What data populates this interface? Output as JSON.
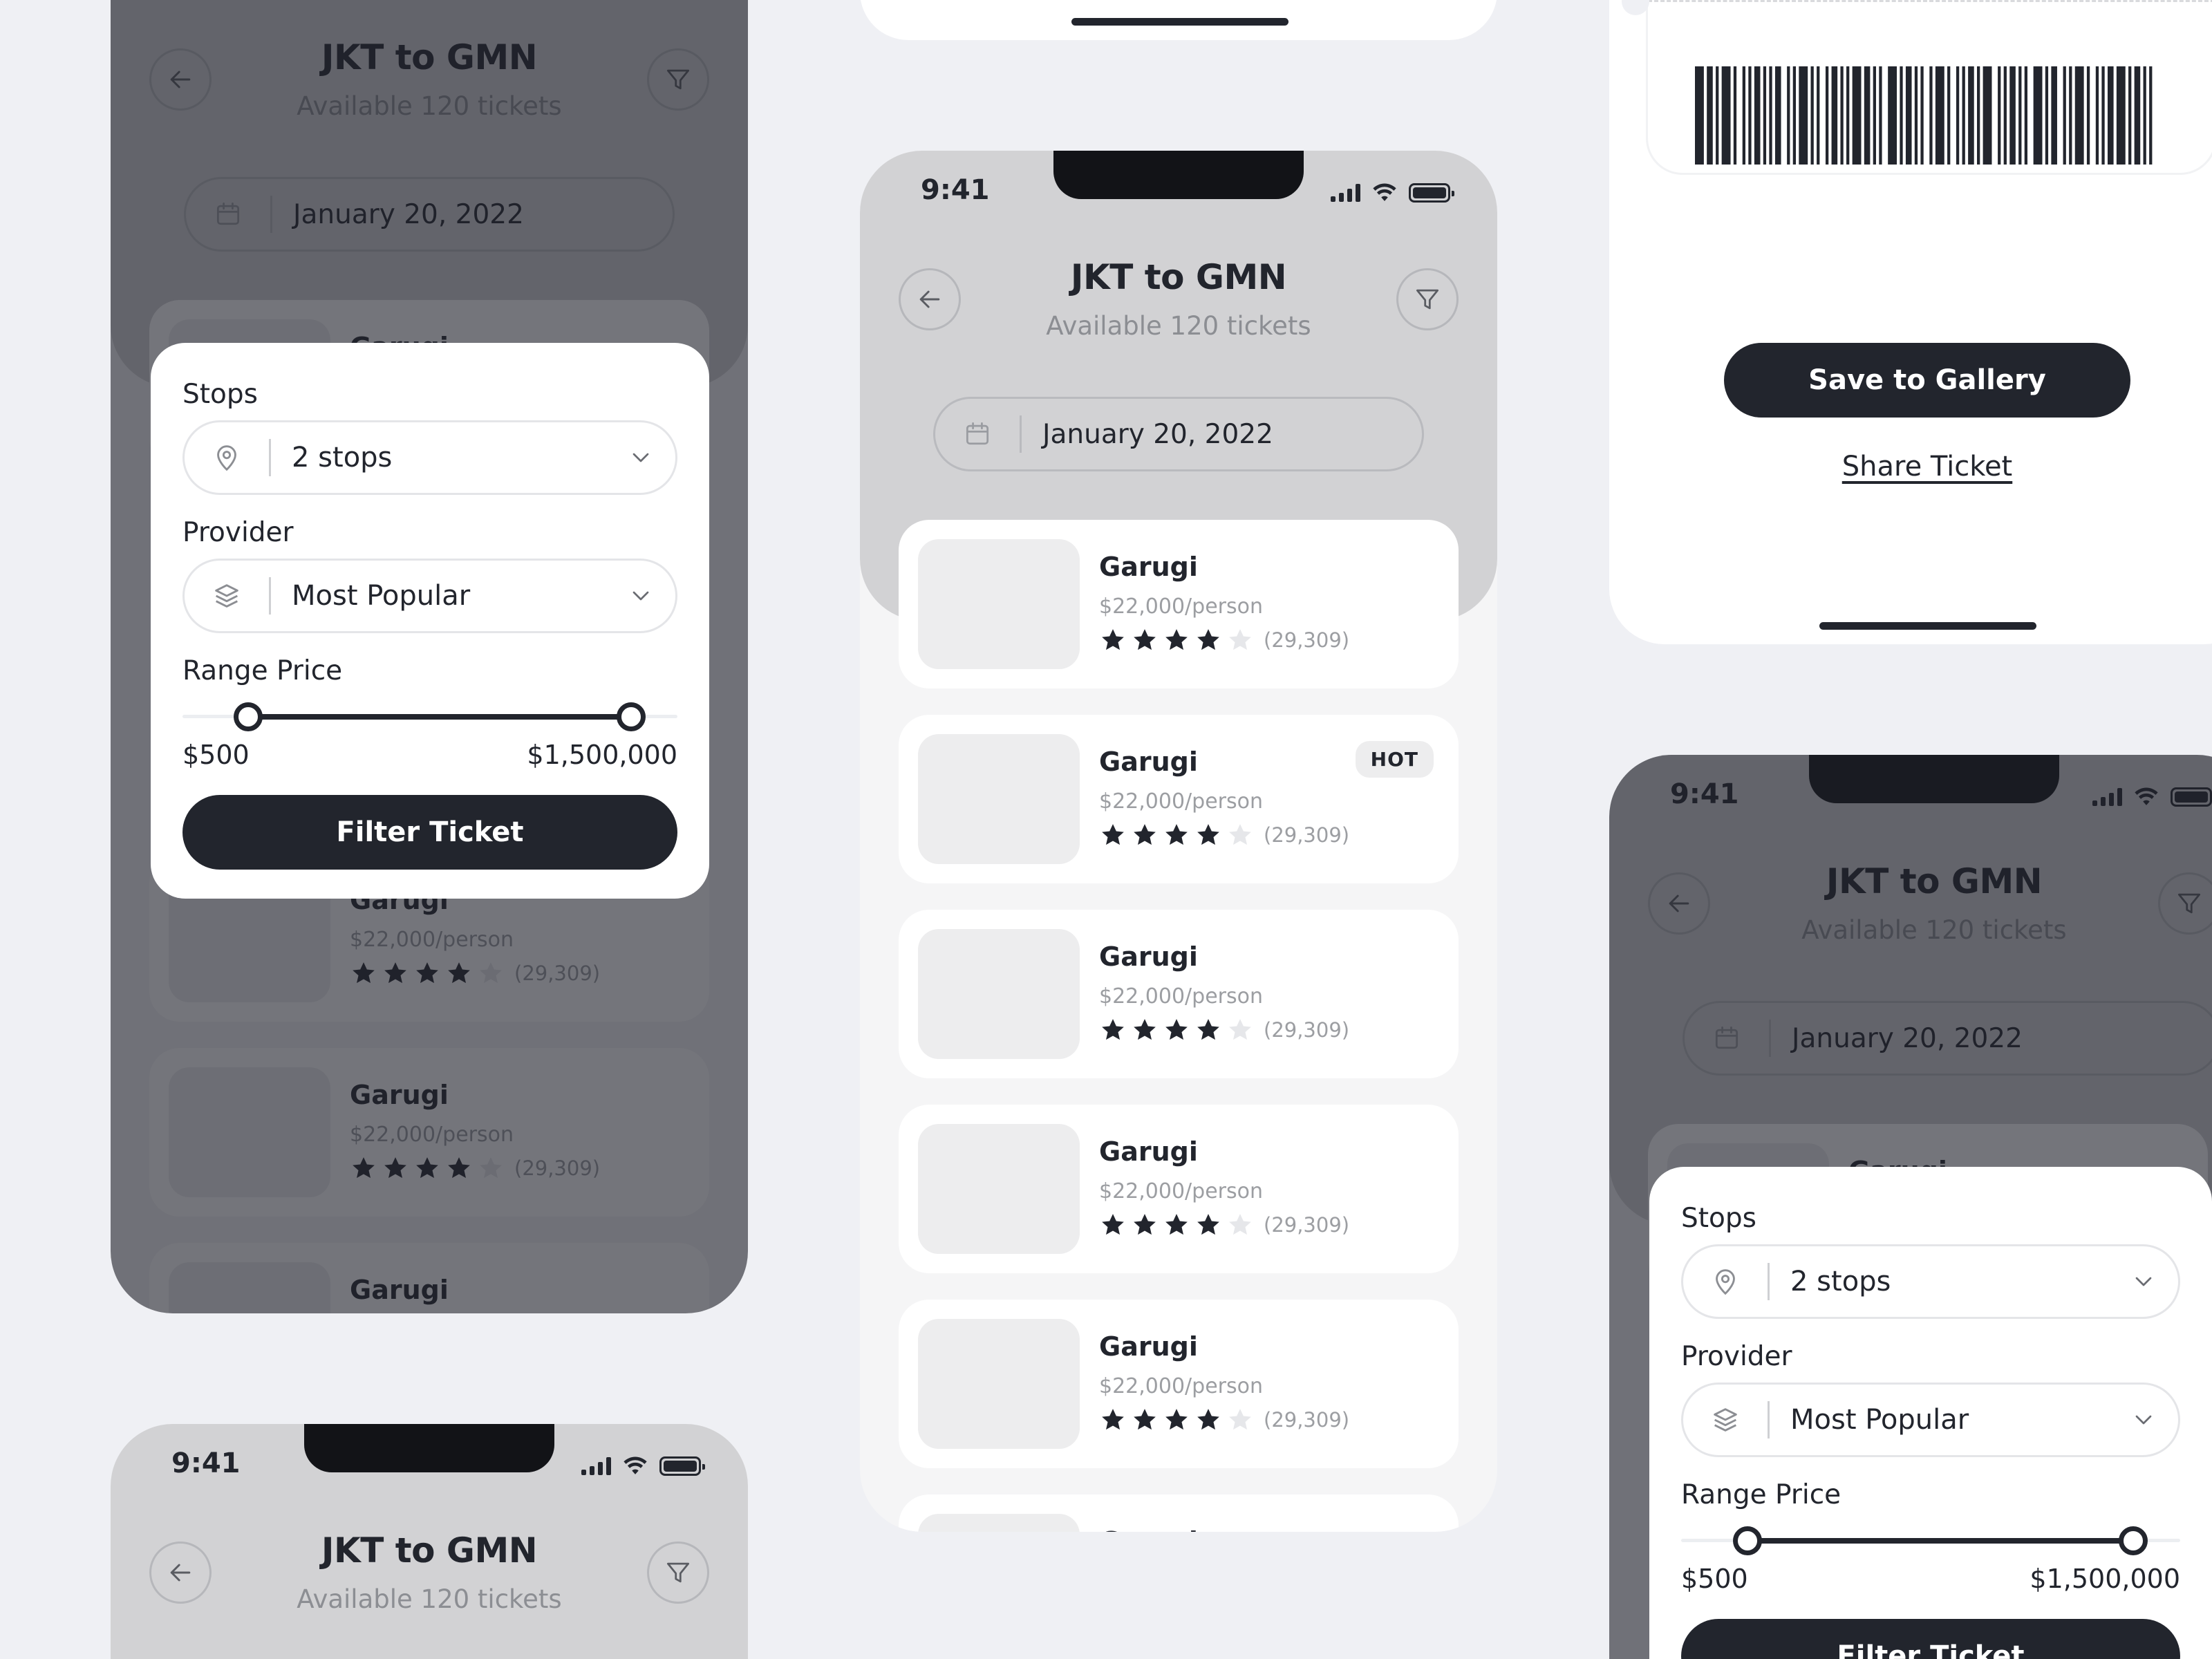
{
  "status": {
    "time": "9:41"
  },
  "header": {
    "title": "JKT to GMN",
    "subtitle": "Available 120 tickets",
    "date": "January 20, 2022"
  },
  "tickets": [
    {
      "name": "Garugi",
      "price": "$22,000/person",
      "rating": 4,
      "reviews": "(29,309)",
      "badge": ""
    },
    {
      "name": "Garugi",
      "price": "$22,000/person",
      "rating": 4,
      "reviews": "(29,309)",
      "badge": "HOT"
    },
    {
      "name": "Garugi",
      "price": "$22,000/person",
      "rating": 4,
      "reviews": "(29,309)",
      "badge": ""
    },
    {
      "name": "Garugi",
      "price": "$22,000/person",
      "rating": 4,
      "reviews": "(29,309)",
      "badge": ""
    },
    {
      "name": "Garugi",
      "price": "$22,000/person",
      "rating": 4,
      "reviews": "(29,309)",
      "badge": ""
    },
    {
      "name": "Garugi",
      "price": "",
      "rating": 0,
      "reviews": "",
      "badge": ""
    }
  ],
  "filter": {
    "stops_label": "Stops",
    "stops_value": "2 stops",
    "provider_label": "Provider",
    "provider_value": "Most Popular",
    "range_label": "Range Price",
    "range_min": "$500",
    "range_max": "$1,500,000",
    "range_min_pos": 0.133,
    "range_max_pos": 0.906,
    "button_label": "Filter Ticket"
  },
  "ticket_actions": {
    "save_label": "Save to Gallery",
    "share_label": "Share Ticket"
  },
  "colors": {
    "dark": "#22252d",
    "header_gray": "#d2d2d4",
    "page_bg": "#eff0f4"
  },
  "icons": [
    "back-arrow-icon",
    "filter-funnel-icon",
    "calendar-icon",
    "star-icon",
    "location-pin-icon",
    "layers-icon",
    "chevron-down-icon",
    "signal-icon",
    "wifi-icon",
    "battery-icon",
    "barcode"
  ]
}
